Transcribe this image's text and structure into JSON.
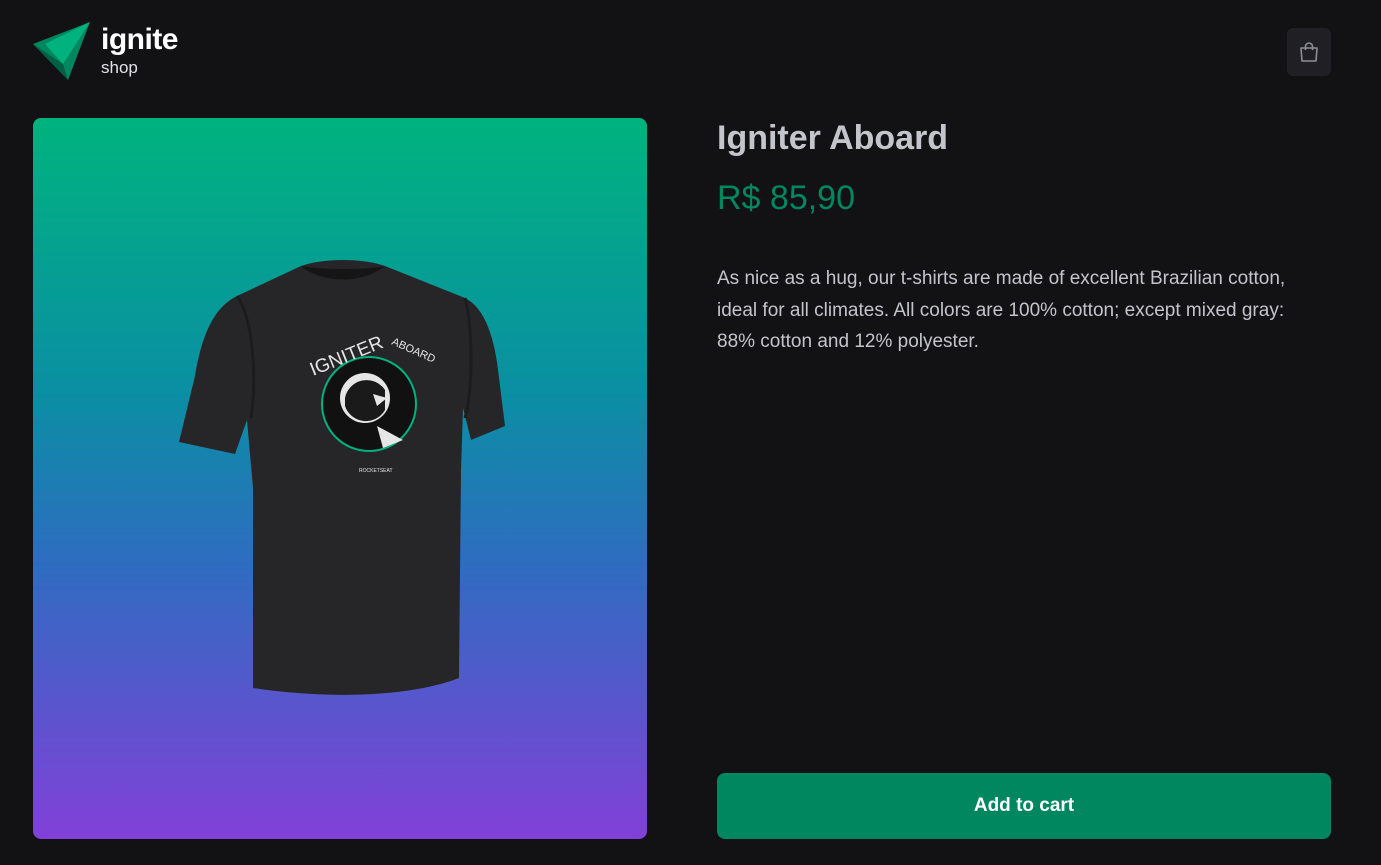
{
  "brand": {
    "name": "ignite",
    "subtitle": "shop",
    "logo_icon": "triangle-logo-icon",
    "accent_color": "#00875f"
  },
  "header": {
    "cart_icon": "shopping-bag-icon"
  },
  "product": {
    "title": "Igniter Aboard",
    "price": "R$ 85,90",
    "description": "As nice as a hug, our t-shirts are made of excellent Brazilian cotton, ideal for all climates. All colors are 100% cotton; except mixed gray: 88% cotton and 12% polyester.",
    "image": {
      "print_text_main": "IGNITER",
      "print_text_sub": "ABOARD",
      "print_brand": "ROCKETSEAT",
      "gradient_top": "#00b37e",
      "gradient_bottom": "#8240d8"
    }
  },
  "actions": {
    "add_to_cart_label": "Add to cart"
  }
}
